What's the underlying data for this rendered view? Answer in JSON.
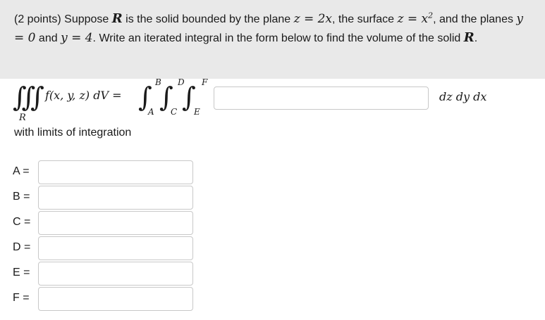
{
  "problem": {
    "points": "(2 points)",
    "t1": " Suppose ",
    "R": "R",
    "t2": " is the solid bounded by the plane ",
    "plane_eq": "z = 2x",
    "t3": ", the surface ",
    "surface_lhs": "z = x",
    "surface_exp": "2",
    "t4": ", and the planes ",
    "y0": "y = 0",
    "t5": " and ",
    "y4": "y = 4",
    "t6": ". Write an iterated integral in the form below to find the volume of the solid ",
    "t7": "."
  },
  "formula": {
    "triple_integral": "∭",
    "region": "R",
    "integrand": "f(x, y, z) dV =",
    "integral_sign": "∫",
    "limits": {
      "A": "A",
      "B": "B",
      "C": "C",
      "D": "D",
      "E": "E",
      "F": "F"
    },
    "differentials": "dz dy dx"
  },
  "limits_label": "with limits of integration",
  "fields": [
    {
      "label": "A =",
      "value": ""
    },
    {
      "label": "B =",
      "value": ""
    },
    {
      "label": "C =",
      "value": ""
    },
    {
      "label": "D =",
      "value": ""
    },
    {
      "label": "E =",
      "value": ""
    },
    {
      "label": "F =",
      "value": ""
    }
  ],
  "colors": {
    "problem_background": "#e9e9e9",
    "input_border": "#c8c8c8",
    "text": "#1a1a1a"
  }
}
